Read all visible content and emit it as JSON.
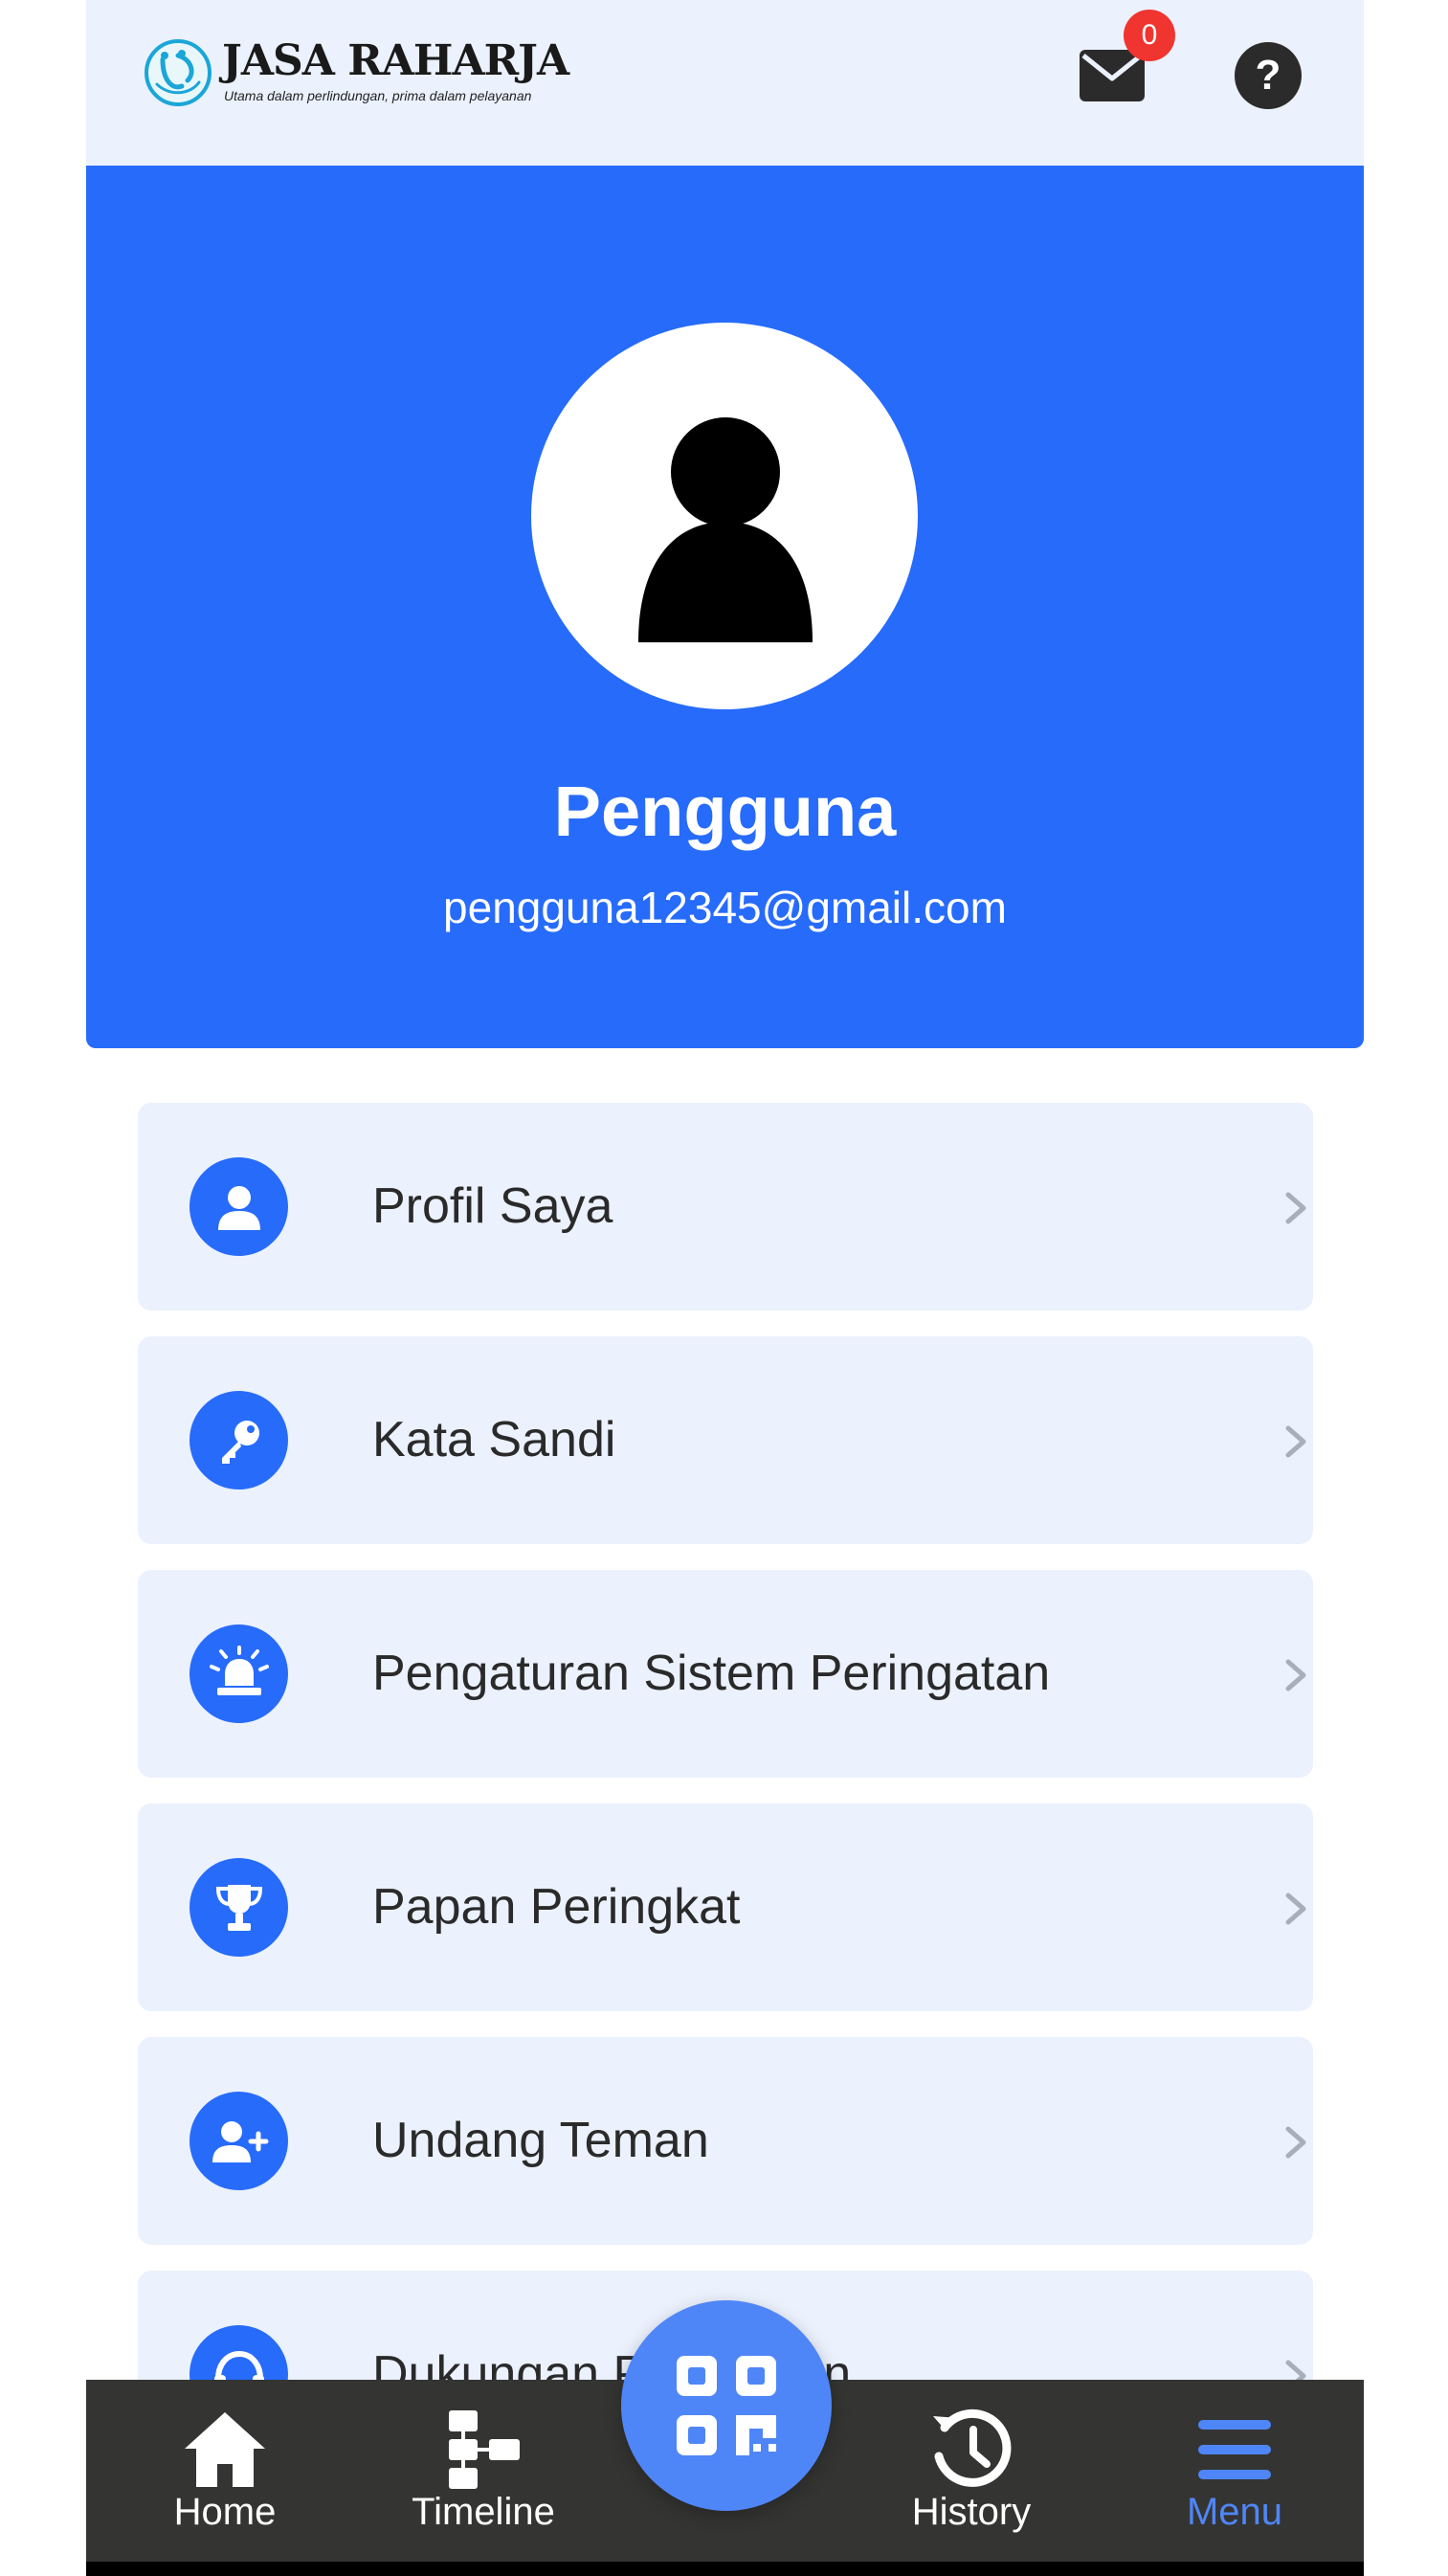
{
  "header": {
    "logo_title": "JASA RAHARJA",
    "logo_tagline": "Utama dalam perlindungan, prima dalam pelayanan",
    "mail_badge_count": "0",
    "help_icon": "?"
  },
  "profile": {
    "name": "Pengguna",
    "email": "pengguna12345@gmail.com"
  },
  "menu": {
    "items": [
      {
        "label": "Profil Saya",
        "icon": "user-icon"
      },
      {
        "label": "Kata Sandi",
        "icon": "key-icon"
      },
      {
        "label": "Pengaturan Sistem Peringatan",
        "icon": "siren-icon"
      },
      {
        "label": "Papan Peringkat",
        "icon": "trophy-icon"
      },
      {
        "label": "Undang Teman",
        "icon": "add-user-icon"
      },
      {
        "label": "Dukungan Pelanggan",
        "icon": "headset-icon"
      }
    ]
  },
  "bottom_nav": {
    "home": "Home",
    "timeline": "Timeline",
    "history": "History",
    "menu": "Menu",
    "active": "Menu"
  },
  "colors": {
    "primary": "#276bfb",
    "nav_active": "#4f86f7",
    "nav_background": "#343432",
    "card_background": "#ebf1fd",
    "badge": "#f0342f"
  }
}
